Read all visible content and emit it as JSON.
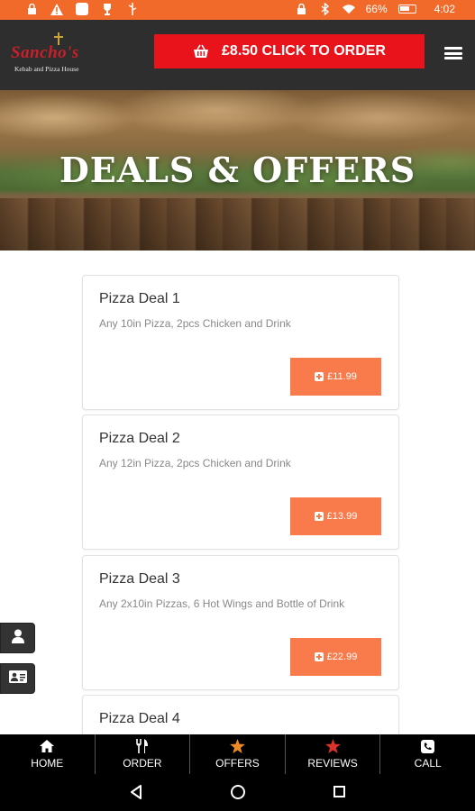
{
  "status_bar": {
    "battery": "66%",
    "time": "4:02",
    "left_icons": [
      "lock-icon",
      "warning-icon",
      "app-icon",
      "trophy-icon",
      "usb-icon"
    ],
    "right_icons": [
      "lock-icon",
      "bluetooth-icon",
      "wifi-icon",
      "battery-icon"
    ]
  },
  "header": {
    "logo_name": "Sancho's",
    "logo_sub": "Kebab and Pizza House",
    "order_button": "£8.50 CLICK TO ORDER",
    "colors": {
      "header_bg": "#2e2e2e",
      "order_button": "#e8131b",
      "status_bar": "#f26a2a"
    }
  },
  "hero": {
    "title": "DEALS & OFFERS"
  },
  "deals": [
    {
      "title": "Pizza Deal 1",
      "description": "Any 10in Pizza, 2pcs Chicken and Drink",
      "price": "£11.99"
    },
    {
      "title": "Pizza Deal 2",
      "description": "Any 12in Pizza, 2pcs Chicken and Drink",
      "price": "£13.99"
    },
    {
      "title": "Pizza Deal 3",
      "description": "Any 2x10in Pizzas, 6 Hot Wings and Bottle of Drink",
      "price": "£22.99"
    },
    {
      "title": "Pizza Deal 4",
      "description": "",
      "price": ""
    }
  ],
  "deal_price_color": "#f97a4a",
  "side_buttons": [
    "user-icon",
    "contact-card-icon"
  ],
  "bottom_nav": [
    {
      "label": "HOME",
      "icon": "home-icon",
      "icon_color": "#ffffff"
    },
    {
      "label": "ORDER",
      "icon": "cutlery-icon",
      "icon_color": "#ffffff"
    },
    {
      "label": "OFFERS",
      "icon": "star-icon",
      "icon_color": "#f08a24"
    },
    {
      "label": "REVIEWS",
      "icon": "star-icon",
      "icon_color": "#d9332b"
    },
    {
      "label": "CALL",
      "icon": "phone-icon",
      "icon_color": "#ffffff"
    }
  ]
}
